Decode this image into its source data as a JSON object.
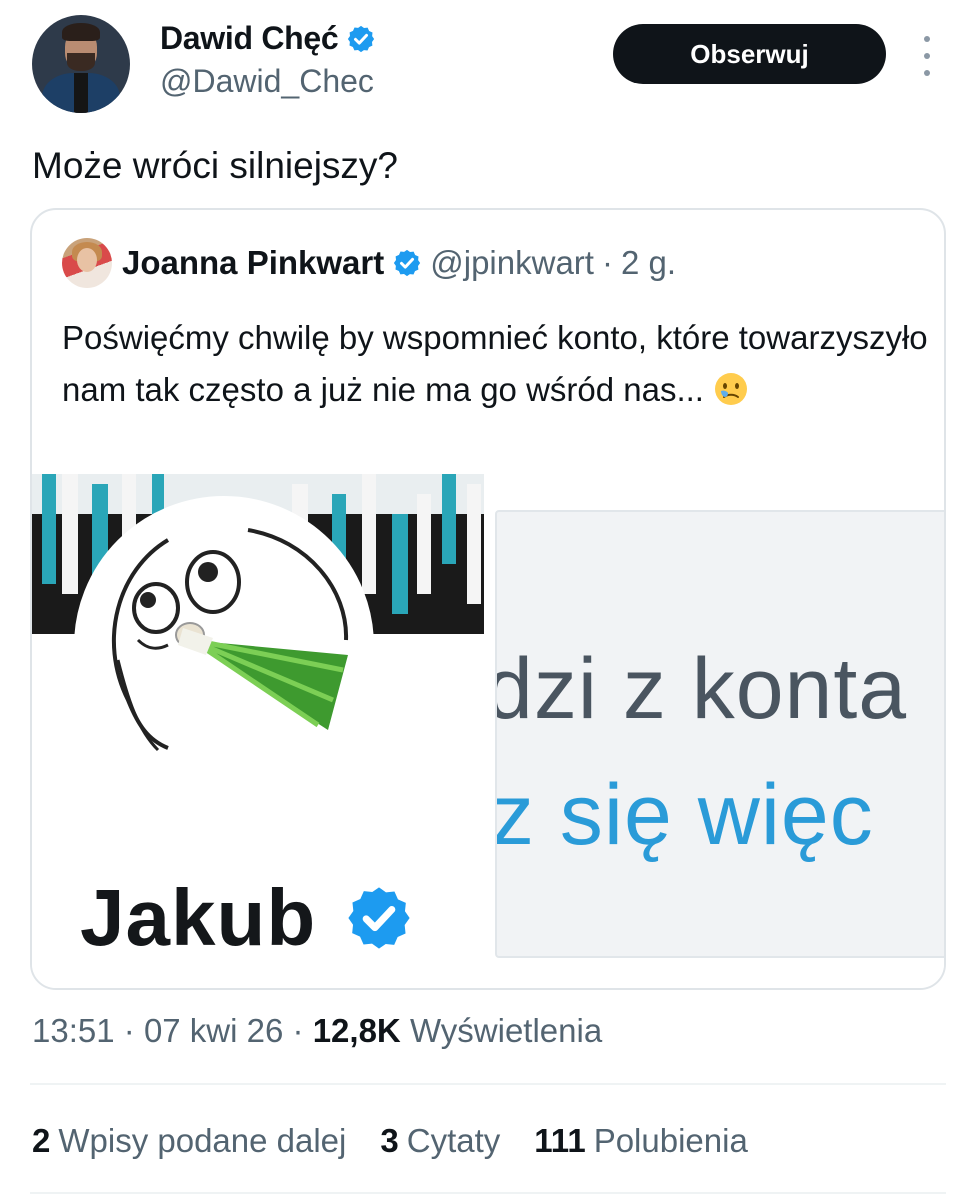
{
  "tweet": {
    "author": {
      "name": "Dawid Chęć",
      "handle": "@Dawid_Chec",
      "verified": true
    },
    "follow_label": "Obserwuj",
    "more_icon": "more-vertical-icon",
    "text": "Może wróci silniejszy?",
    "quote": {
      "author_name": "Joanna Pinkwart",
      "verified": true,
      "handle": "@jpinkwart",
      "separator": "·",
      "time": "2 g.",
      "text": "Poświęćmy chwilę by wspomnieć konto, które towarzyszyło nam tak często a już nie ma go wśród nas...",
      "emoji": "face-holding-back-tears",
      "media": {
        "left_profile_name": "Jakub",
        "left_profile_verified": true,
        "right_line1": "dzi z konta",
        "right_line2": "z się więc"
      }
    },
    "meta": {
      "time": "13:51",
      "sep1": "·",
      "date": "07 kwi 26",
      "sep2": "·",
      "views_count": "12,8K",
      "views_label": "Wyświetlenia"
    },
    "stats": {
      "retweets_count": "2",
      "retweets_label": "Wpisy podane dalej",
      "quotes_count": "3",
      "quotes_label": "Cytaty",
      "likes_count": "111",
      "likes_label": "Polubienia"
    }
  },
  "colors": {
    "verified_blue": "#1d9bf0",
    "text_primary": "#0f1419",
    "text_secondary": "#536471",
    "border": "#dfe4e8"
  }
}
